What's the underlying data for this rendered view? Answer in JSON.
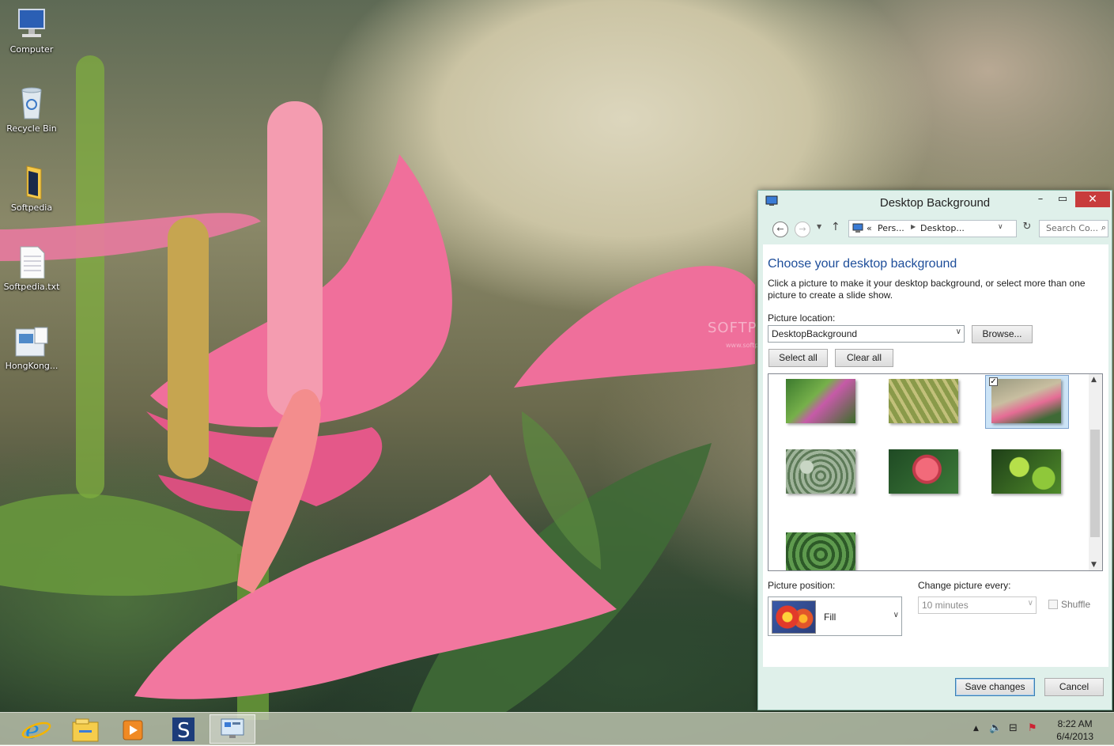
{
  "desktop": {
    "icons": [
      {
        "label": "Computer",
        "icon": "computer-icon"
      },
      {
        "label": "Recycle Bin",
        "icon": "recycle-bin-icon"
      },
      {
        "label": "Softpedia",
        "icon": "folder-icon"
      },
      {
        "label": "Softpedia.txt",
        "icon": "text-file-icon"
      },
      {
        "label": "HongKong...",
        "icon": "shortcut-icon"
      }
    ],
    "watermark": "SOFTPEDIA",
    "watermark_url": "www.softpedia.com"
  },
  "dialog": {
    "title": "Desktop Background",
    "window_buttons": {
      "minimize": "–",
      "maximize": "▭",
      "close": "✕"
    },
    "address": {
      "sep": "«",
      "crumb1": "Pers...",
      "crumb2": "Desktop..."
    },
    "search_placeholder": "Search Co...",
    "heading": "Choose your desktop background",
    "description": "Click a picture to make it your desktop background, or select more than one picture to create a slide show.",
    "picture_location_label": "Picture location:",
    "picture_location_value": "DesktopBackground",
    "browse_label": "Browse...",
    "select_all_label": "Select all",
    "clear_all_label": "Clear all",
    "thumbnails": [
      {
        "name": "thumb-flowers-purple",
        "selected": false
      },
      {
        "name": "thumb-palm-leaf",
        "selected": false
      },
      {
        "name": "thumb-pink-anthurium",
        "selected": true
      },
      {
        "name": "thumb-succulent",
        "selected": false
      },
      {
        "name": "thumb-red-flower",
        "selected": false
      },
      {
        "name": "thumb-green-leaves",
        "selected": false
      },
      {
        "name": "thumb-ground-plants",
        "selected": false
      }
    ],
    "picture_position_label": "Picture position:",
    "picture_position_value": "Fill",
    "change_picture_label": "Change picture every:",
    "change_picture_value": "10 minutes",
    "shuffle_label": "Shuffle",
    "save_label": "Save changes",
    "cancel_label": "Cancel"
  },
  "taskbar": {
    "items": [
      "internet-explorer-icon",
      "file-explorer-icon",
      "media-player-icon",
      "softpedia-s-icon",
      "control-panel-icon"
    ],
    "time": "8:22 AM",
    "date": "6/4/2013"
  }
}
